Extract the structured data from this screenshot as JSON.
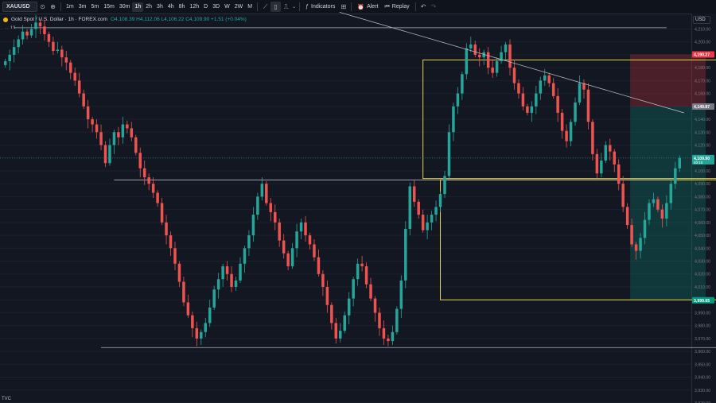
{
  "toolbar": {
    "symbol": "XAUUSD",
    "timeframes": [
      "1m",
      "3m",
      "5m",
      "15m",
      "30m",
      "1h",
      "2h",
      "3h",
      "4h",
      "8h",
      "12h",
      "D",
      "3D",
      "W",
      "2W",
      "M"
    ],
    "active_timeframe": "1h",
    "indicators_label": "Indicators",
    "alert_label": "Alert",
    "replay_label": "Replay"
  },
  "legend": {
    "title": "Gold Spot / U.S. Dollar · 1h · FOREX.com",
    "ohlc": "O4,108.39 H4,112.06 L4,106.22 C4,109.90 +1.51 (+0.04%)",
    "indicator_count": "13"
  },
  "price_axis": {
    "currency": "USD",
    "ticks": [
      "4,210.00",
      "4,200.00",
      "4,190.00",
      "4,180.00",
      "4,170.00",
      "4,160.00",
      "4,150.00",
      "4,140.00",
      "4,130.00",
      "4,120.00",
      "4,110.00",
      "4,100.00",
      "4,090.00",
      "4,080.00",
      "4,070.00",
      "4,060.00",
      "4,050.00",
      "4,040.00",
      "4,030.00",
      "4,020.00",
      "4,010.00",
      "4,000.00",
      "3,990.00",
      "3,980.00",
      "3,970.00",
      "3,960.00",
      "3,950.00",
      "3,940.00",
      "3,930.00",
      "3,920.00"
    ],
    "labels": [
      {
        "text": "4,190.27",
        "price": 4190.27,
        "color": "#f23645"
      },
      {
        "text": "4,149.87",
        "price": 4149.87,
        "color": "#787b86"
      },
      {
        "text": "4,109.90",
        "sub": "40:16",
        "price": 4109.9,
        "color": "#26a69a"
      },
      {
        "text": "3,999.65",
        "price": 3999.65,
        "color": "#089981"
      }
    ]
  },
  "bottom_label": "TVC",
  "colors": {
    "up": "#26a69a",
    "down": "#ef5350",
    "zone": "#e6d34a",
    "stop": "#f23645",
    "target": "#089981",
    "line": "#b2b5be"
  },
  "chart_data": {
    "type": "candlestick",
    "timeframe": "1h",
    "ylim": [
      3920,
      4222
    ],
    "levels": [
      4211,
      4093,
      3963
    ],
    "trendline": [
      [
        0,
        4223
      ],
      [
        156,
        4145
      ]
    ],
    "rectangles": [
      {
        "x0": 96,
        "x1": 174,
        "top": 4186,
        "bottom": 4094
      },
      {
        "x0": 100,
        "x1": 179,
        "top": 4093,
        "bottom": 4000
      }
    ],
    "position": {
      "type": "short",
      "entry": 4149.87,
      "stop": 4190.27,
      "target": 3999.65
    },
    "last_price": 4109.9,
    "closes": [
      4185,
      4190,
      4196,
      4202,
      4208,
      4205,
      4210,
      4215,
      4212,
      4206,
      4200,
      4193,
      4194,
      4188,
      4184,
      4176,
      4170,
      4160,
      4150,
      4140,
      4136,
      4130,
      4120,
      4106,
      4120,
      4130,
      4126,
      4136,
      4133,
      4126,
      4114,
      4102,
      4095,
      4090,
      4083,
      4075,
      4060,
      4050,
      4040,
      4028,
      4014,
      3998,
      3988,
      3978,
      3970,
      3975,
      3982,
      3994,
      4008,
      4016,
      4026,
      4020,
      4010,
      4015,
      4028,
      4040,
      4050,
      4066,
      4080,
      4090,
      4075,
      4068,
      4060,
      4046,
      4036,
      4026,
      4040,
      4053,
      4060,
      4050,
      4043,
      4033,
      4020,
      4010,
      3996,
      3982,
      3970,
      3976,
      3988,
      4001,
      4016,
      4028,
      4026,
      4012,
      4001,
      3990,
      3978,
      3970,
      3968,
      3975,
      3993,
      4015,
      4055,
      4088,
      4076,
      4066,
      4054,
      4060,
      4066,
      4072,
      4082,
      4096,
      4130,
      4150,
      4160,
      4175,
      4195,
      4198,
      4190,
      4188,
      4192,
      4180,
      4176,
      4185,
      4192,
      4198,
      4180,
      4168,
      4160,
      4150,
      4145,
      4150,
      4160,
      4170,
      4174,
      4168,
      4158,
      4145,
      4131,
      4123,
      4138,
      4153,
      4168,
      4163,
      4138,
      4113,
      4098,
      4108,
      4120,
      4115,
      4105,
      4090,
      4072,
      4058,
      4043,
      4038,
      4048,
      4062,
      4075,
      4078,
      4070,
      4063,
      4075,
      4090,
      4102,
      4110
    ]
  }
}
